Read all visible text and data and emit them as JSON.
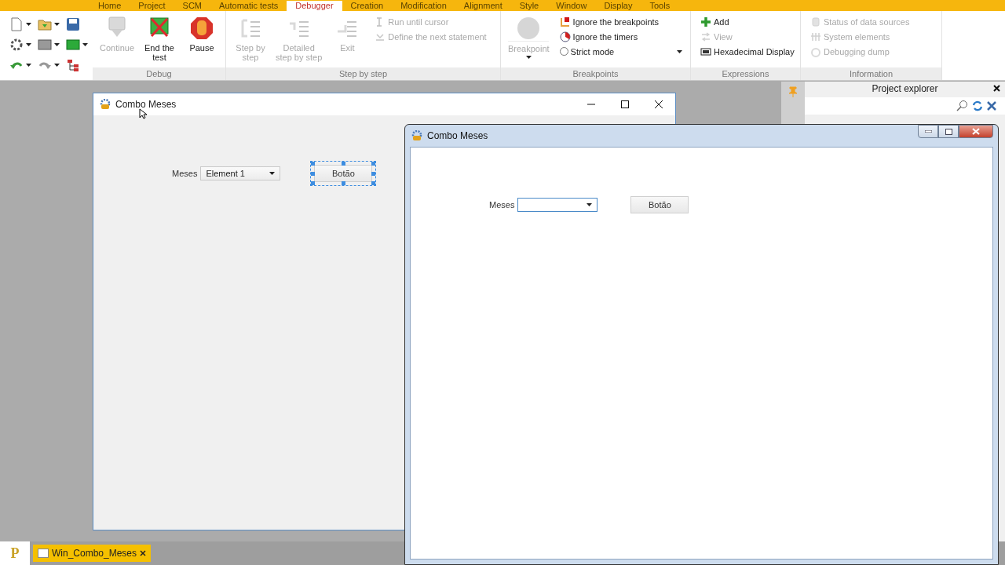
{
  "ribbon_tabs": [
    {
      "label": "Home",
      "selected": false
    },
    {
      "label": "Project",
      "selected": false
    },
    {
      "label": "SCM",
      "selected": false
    },
    {
      "label": "Automatic tests",
      "selected": false
    },
    {
      "label": "Debugger",
      "selected": true
    },
    {
      "label": "Creation",
      "selected": false
    },
    {
      "label": "Modification",
      "selected": false
    },
    {
      "label": "Alignment",
      "selected": false
    },
    {
      "label": "Style",
      "selected": false
    },
    {
      "label": "Window",
      "selected": false
    },
    {
      "label": "Display",
      "selected": false
    },
    {
      "label": "Tools",
      "selected": false
    }
  ],
  "ribbon_groups": [
    {
      "title": "Debug",
      "large_buttons": [
        {
          "label": "Continue",
          "disabled": true
        },
        {
          "label": "End the\ntest",
          "disabled": false
        },
        {
          "label": "Pause",
          "disabled": false
        }
      ]
    },
    {
      "title": "Step by step",
      "large_buttons": [
        {
          "label": "Step by\nstep",
          "disabled": true
        },
        {
          "label": "Detailed\nstep by step",
          "disabled": true
        },
        {
          "label": "Exit",
          "disabled": true
        }
      ],
      "small_buttons": [
        {
          "kind": "command",
          "label": "Run until cursor",
          "disabled": true
        },
        {
          "kind": "command",
          "label": "Define the next statement",
          "disabled": true
        }
      ]
    },
    {
      "title": "Breakpoints",
      "large_buttons": [
        {
          "label": "Breakpoint",
          "disabled": true,
          "dropdown": true
        }
      ],
      "small_buttons": [
        {
          "kind": "command",
          "label": "Ignore the breakpoints",
          "disabled": false
        },
        {
          "kind": "command",
          "label": "Ignore the timers",
          "disabled": false
        },
        {
          "kind": "radio",
          "label": "Strict mode",
          "checked": false,
          "dropdown": true
        }
      ]
    },
    {
      "title": "Expressions",
      "small_buttons": [
        {
          "kind": "command",
          "label": "Add",
          "disabled": false
        },
        {
          "kind": "command",
          "label": "View",
          "disabled": true
        },
        {
          "kind": "command",
          "label": "Hexadecimal Display",
          "disabled": false
        }
      ]
    },
    {
      "title": "Information",
      "small_buttons": [
        {
          "kind": "command",
          "label": "Status of data sources",
          "disabled": true
        },
        {
          "kind": "command",
          "label": "System elements",
          "disabled": true
        },
        {
          "kind": "command",
          "label": "Debugging dump",
          "disabled": true
        }
      ]
    }
  ],
  "project_explorer": {
    "title": "Project explorer"
  },
  "editor_window": {
    "title": "Combo Meses",
    "label": "Meses",
    "combo_value": "Element 1",
    "button": {
      "label": "Botão",
      "selected": true
    }
  },
  "runtime_window": {
    "title": "Combo Meses",
    "label": "Meses",
    "button": {
      "label": "Botão",
      "selected": false
    }
  },
  "taskbar": {
    "logo": "P",
    "tabs": [
      {
        "label": "Win_Combo_Meses",
        "selected": true
      }
    ]
  }
}
